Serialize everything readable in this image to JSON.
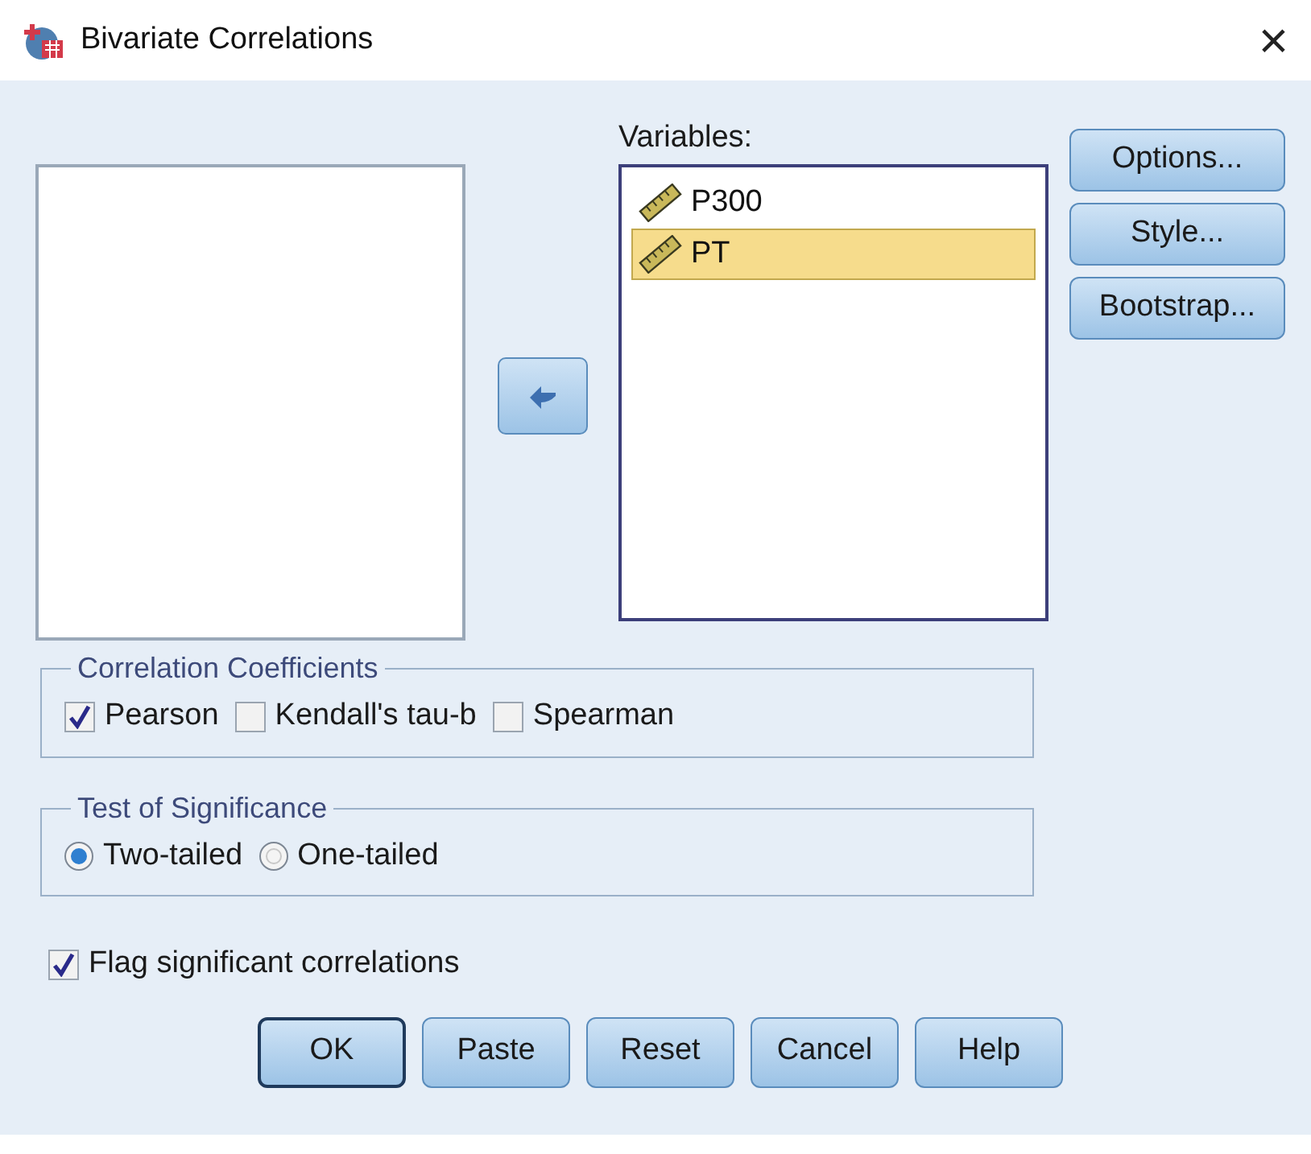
{
  "window": {
    "title": "Bivariate Correlations",
    "close": "×"
  },
  "variables_label": "Variables:",
  "variables": [
    {
      "name": "P300",
      "selected": false
    },
    {
      "name": "PT",
      "selected": true
    }
  ],
  "side_buttons": [
    "Options...",
    "Style...",
    "Bootstrap..."
  ],
  "coefficients": {
    "title": "Correlation Coefficients",
    "options": [
      {
        "label": "Pearson",
        "checked": true
      },
      {
        "label": "Kendall's tau-b",
        "checked": false
      },
      {
        "label": "Spearman",
        "checked": false
      }
    ]
  },
  "significance": {
    "title": "Test of Significance",
    "options": [
      {
        "label": "Two-tailed",
        "selected": true
      },
      {
        "label": "One-tailed",
        "selected": false
      }
    ]
  },
  "flag": {
    "label": "Flag significant correlations",
    "checked": true
  },
  "buttons": [
    {
      "label": "OK",
      "default": true
    },
    {
      "label": "Paste",
      "default": false
    },
    {
      "label": "Reset",
      "default": false
    },
    {
      "label": "Cancel",
      "default": false
    },
    {
      "label": "Help",
      "default": false
    }
  ]
}
